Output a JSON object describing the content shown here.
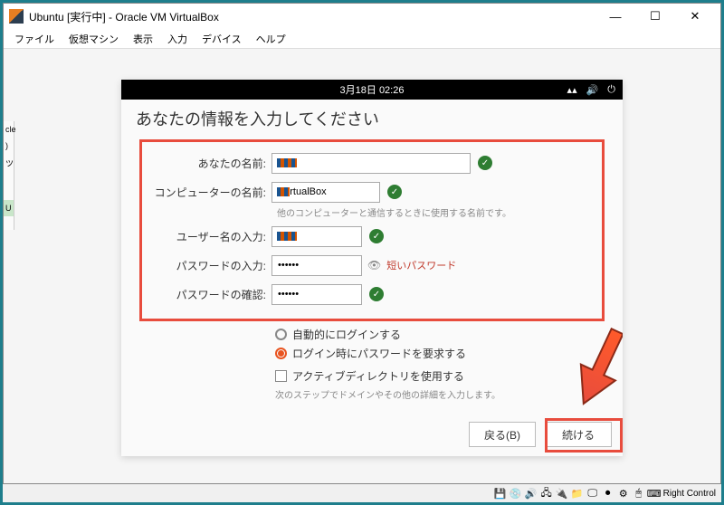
{
  "window": {
    "title": "Ubuntu [実行中] - Oracle VM VirtualBox"
  },
  "menu": {
    "file": "ファイル",
    "machine": "仮想マシン",
    "view": "表示",
    "input": "入力",
    "devices": "デバイス",
    "help": "ヘルプ"
  },
  "topbar": {
    "datetime": "3月18日  02:26"
  },
  "page": {
    "heading": "あなたの情報を入力してください"
  },
  "form": {
    "name_label": "あなたの名前:",
    "computer_label": "コンピューターの名前:",
    "computer_value": "-VirtualBox",
    "computer_hint": "他のコンピューターと通信するときに使用する名前です。",
    "username_label": "ユーザー名の入力:",
    "password_label": "パスワードの入力:",
    "password_warn": "短いパスワード",
    "confirm_label": "パスワードの確認:"
  },
  "options": {
    "auto_login": "自動的にログインする",
    "require_pw": "ログイン時にパスワードを要求する",
    "ad": "アクティブディレクトリを使用する",
    "ad_hint": "次のステップでドメインやその他の詳細を入力します。"
  },
  "buttons": {
    "back": "戻る(B)",
    "continue": "続ける"
  },
  "status": {
    "hostkey": "Right Control"
  }
}
